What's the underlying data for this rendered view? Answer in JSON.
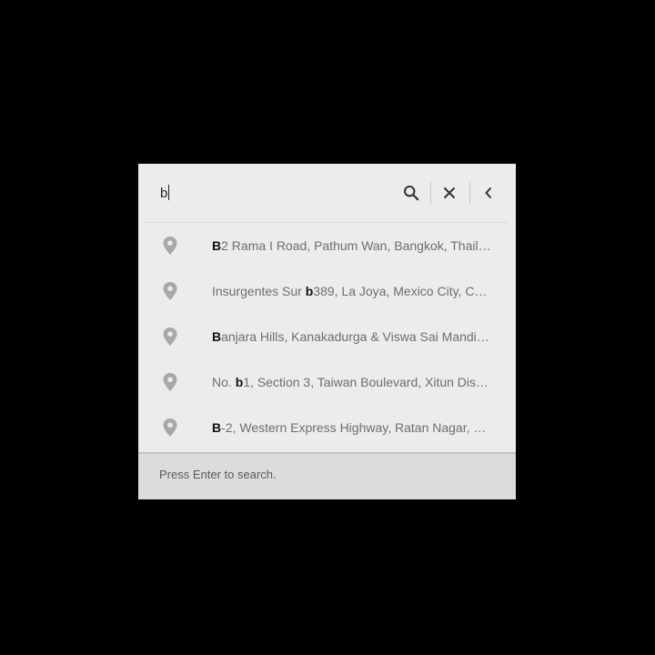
{
  "search": {
    "query": "b",
    "icons": [
      "search-icon",
      "close-icon",
      "chevron-left-icon"
    ]
  },
  "results": [
    {
      "bold": "B",
      "rest": "2 Rama I Road, Pathum Wan, Bangkok, Thail…",
      "pre": "",
      "icon": "location-pin-icon"
    },
    {
      "pre": "Insurgentes Sur ",
      "bold": "b",
      "rest": "389, La Joya, Mexico City, C…",
      "icon": "location-pin-icon"
    },
    {
      "pre": "",
      "bold": "B",
      "rest": "anjara Hills, Kanakadurga & Viswa Sai Mandi…",
      "icon": "location-pin-icon"
    },
    {
      "pre": "No. ",
      "bold": "b",
      "rest": "1, Section 3, Taiwan Boulevard, Xitun Dis…",
      "icon": "location-pin-icon"
    },
    {
      "pre": "",
      "bold": "B",
      "rest": "-2, Western Express Highway, Ratan Nagar, B…",
      "icon": "location-pin-icon"
    }
  ],
  "footer": {
    "hint": "Press Enter to search."
  },
  "colors": {
    "background": "#000000",
    "panel": "#ececec",
    "footer": "#dcdcdc",
    "pin": "#a8a8a8",
    "match_text": "#111111",
    "secondary_text": "#6e6e6e"
  }
}
